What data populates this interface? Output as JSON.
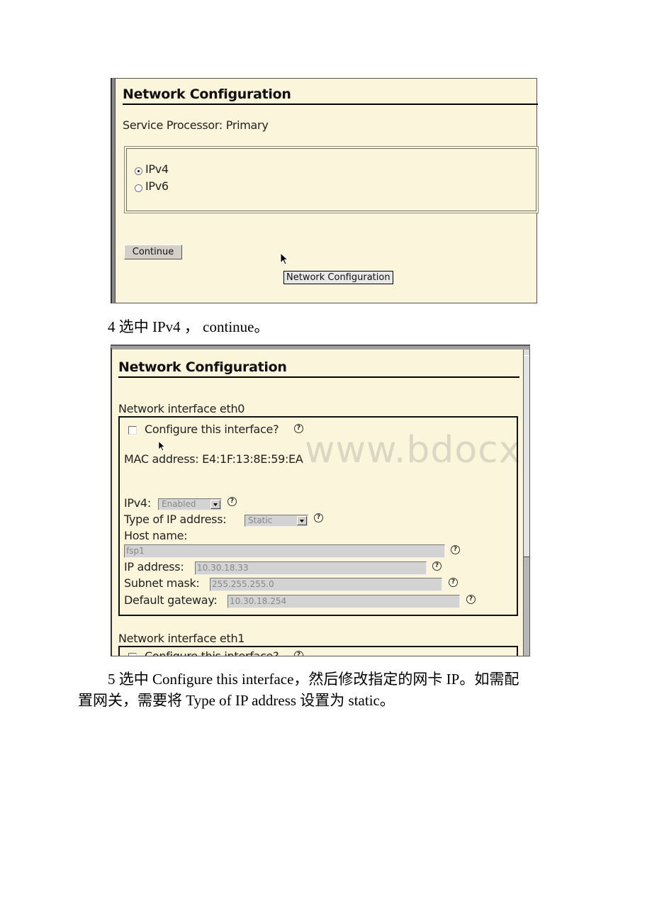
{
  "screenshot1": {
    "title": "Network Configuration",
    "service_processor_label": "Service Processor: Primary",
    "protocol_options": [
      {
        "label": "IPv4",
        "checked": true
      },
      {
        "label": "IPv6",
        "checked": false
      }
    ],
    "continue_label": "Continue",
    "tooltip": "Network Configuration"
  },
  "step4_text": "4 选中 IPv4 ， continue。",
  "screenshot2": {
    "title": "Network Configuration",
    "eth0": {
      "section_label": "Network interface eth0",
      "configure_label": "Configure this interface?",
      "configure_checked": false,
      "mac_label": "MAC address: E4:1F:13:8E:59:EA",
      "ipv4_label": "IPv4:",
      "ipv4_value": "Enabled",
      "ip_type_label": "Type of IP address:",
      "ip_type_value": "Static",
      "host_name_label": "Host name:",
      "host_name_value": "fsp1",
      "ip_address_label": "IP address:",
      "ip_address_value": "10.30.18.33",
      "subnet_mask_label": "Subnet mask:",
      "subnet_mask_value": "255.255.255.0",
      "gateway_label": "Default gateway:",
      "gateway_value": "10.30.18.254"
    },
    "eth1": {
      "section_label": "Network interface eth1",
      "configure_label": "Configure this interface?"
    },
    "help_glyph": "?",
    "watermark": "www.bdocx.com"
  },
  "step5_text_line1": "5 选中 Configure this interface，然后修改指定的网卡 IP。如需配",
  "step5_text_line2": "置网关，需要将 Type of IP address 设置为 static。"
}
